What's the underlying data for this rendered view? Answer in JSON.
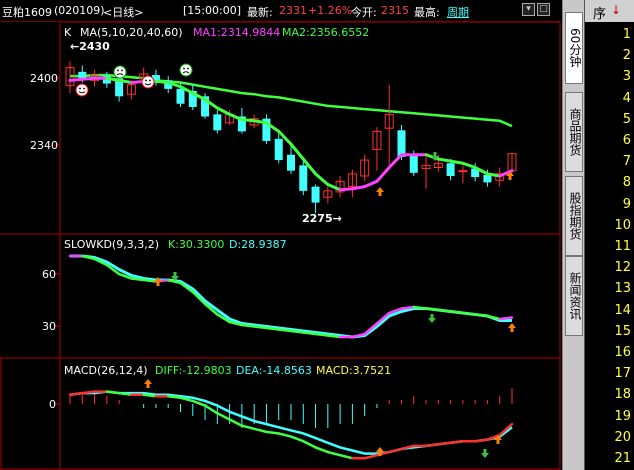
{
  "header": {
    "instrument": "豆粕1609",
    "code": "(020109)",
    "period": "<日线>",
    "time": "[15:00:00]",
    "latest_label": "最新:",
    "latest_value": "2331",
    "change": "+1.26%",
    "open_label": "今开:",
    "open_value": "2315",
    "high_label": "最高:",
    "period_link": "周期"
  },
  "main_panel": {
    "legend_k": "K",
    "legend_ma": "MA(5,10,20,40,60)",
    "ma1": "MA1:2314.9844",
    "ma2": "MA2:2356.6552",
    "y_labels": [
      "2400",
      "2340"
    ],
    "high_marker": "2430",
    "low_marker": "2275"
  },
  "kd_panel": {
    "title": "SLOWKD(9,3,3,2)",
    "k": "K:30.3300",
    "d": "D:28.9387",
    "y_labels": [
      "60",
      "30"
    ]
  },
  "macd_panel": {
    "title": "MACD(26,12,4)",
    "diff": "DIFF:-12.9803",
    "dea": "DEA:-14.8563",
    "macd": "MACD:3.7521",
    "y_labels": [
      "0"
    ]
  },
  "right_tabs": [
    "60分钟",
    "商品期货",
    "股指期货",
    "新闻资讯"
  ],
  "seq_header": "序",
  "seq_numbers": [
    "1",
    "2",
    "3",
    "4",
    "5",
    "6",
    "7",
    "8",
    "9",
    "10",
    "11",
    "12",
    "13",
    "14",
    "15",
    "16",
    "17",
    "18",
    "19",
    "20",
    "21"
  ],
  "colors": {
    "up": "#ff3030",
    "down": "#40ffff",
    "ma_short": "#ff40ff",
    "ma_long": "#40ff40",
    "panel_border": "#b00000",
    "kd_k": "#ff40ff",
    "kd_d": "#40ffff"
  },
  "chart_data": {
    "type": "candlestick",
    "title": "",
    "ylim": [
      2262,
      2438
    ],
    "candles": [
      {
        "o": 2395,
        "h": 2418,
        "l": 2388,
        "c": 2412
      },
      {
        "o": 2408,
        "h": 2414,
        "l": 2398,
        "c": 2402
      },
      {
        "o": 2400,
        "h": 2410,
        "l": 2394,
        "c": 2405
      },
      {
        "o": 2404,
        "h": 2408,
        "l": 2393,
        "c": 2397
      },
      {
        "o": 2402,
        "h": 2410,
        "l": 2380,
        "c": 2385
      },
      {
        "o": 2387,
        "h": 2400,
        "l": 2382,
        "c": 2396
      },
      {
        "o": 2402,
        "h": 2412,
        "l": 2398,
        "c": 2406
      },
      {
        "o": 2405,
        "h": 2410,
        "l": 2395,
        "c": 2399
      },
      {
        "o": 2400,
        "h": 2404,
        "l": 2388,
        "c": 2392
      },
      {
        "o": 2392,
        "h": 2398,
        "l": 2375,
        "c": 2378
      },
      {
        "o": 2390,
        "h": 2396,
        "l": 2372,
        "c": 2375
      },
      {
        "o": 2385,
        "h": 2388,
        "l": 2364,
        "c": 2366
      },
      {
        "o": 2368,
        "h": 2372,
        "l": 2350,
        "c": 2353
      },
      {
        "o": 2360,
        "h": 2372,
        "l": 2358,
        "c": 2368
      },
      {
        "o": 2366,
        "h": 2374,
        "l": 2350,
        "c": 2352
      },
      {
        "o": 2358,
        "h": 2368,
        "l": 2355,
        "c": 2364
      },
      {
        "o": 2364,
        "h": 2368,
        "l": 2340,
        "c": 2343
      },
      {
        "o": 2345,
        "h": 2350,
        "l": 2322,
        "c": 2325
      },
      {
        "o": 2330,
        "h": 2338,
        "l": 2312,
        "c": 2315
      },
      {
        "o": 2320,
        "h": 2324,
        "l": 2292,
        "c": 2296
      },
      {
        "o": 2300,
        "h": 2302,
        "l": 2275,
        "c": 2285
      },
      {
        "o": 2290,
        "h": 2300,
        "l": 2284,
        "c": 2296
      },
      {
        "o": 2295,
        "h": 2310,
        "l": 2290,
        "c": 2305
      },
      {
        "o": 2300,
        "h": 2316,
        "l": 2290,
        "c": 2312
      },
      {
        "o": 2310,
        "h": 2330,
        "l": 2305,
        "c": 2325
      },
      {
        "o": 2335,
        "h": 2356,
        "l": 2315,
        "c": 2352
      },
      {
        "o": 2355,
        "h": 2396,
        "l": 2318,
        "c": 2368
      },
      {
        "o": 2353,
        "h": 2358,
        "l": 2325,
        "c": 2328
      },
      {
        "o": 2330,
        "h": 2334,
        "l": 2310,
        "c": 2313
      },
      {
        "o": 2317,
        "h": 2328,
        "l": 2298,
        "c": 2320
      },
      {
        "o": 2318,
        "h": 2330,
        "l": 2314,
        "c": 2322
      },
      {
        "o": 2322,
        "h": 2326,
        "l": 2306,
        "c": 2310
      },
      {
        "o": 2314,
        "h": 2320,
        "l": 2303,
        "c": 2315
      },
      {
        "o": 2317,
        "h": 2322,
        "l": 2305,
        "c": 2309
      },
      {
        "o": 2311,
        "h": 2316,
        "l": 2300,
        "c": 2304
      },
      {
        "o": 2306,
        "h": 2318,
        "l": 2300,
        "c": 2312
      },
      {
        "o": 2315,
        "h": 2332,
        "l": 2313,
        "c": 2331
      }
    ],
    "ma1": [
      2400,
      2401,
      2402,
      2402,
      2400,
      2398,
      2399,
      2399,
      2398,
      2394,
      2388,
      2382,
      2374,
      2368,
      2363,
      2362,
      2360,
      2352,
      2340,
      2326,
      2312,
      2302,
      2297,
      2298,
      2300,
      2305,
      2318,
      2330,
      2330,
      2330,
      2326,
      2324,
      2322,
      2318,
      2312,
      2310,
      2315
    ],
    "ma2": [
      2404,
      2404,
      2405,
      2405,
      2404,
      2403,
      2402,
      2400,
      2399,
      2398,
      2396,
      2394,
      2392,
      2390,
      2388,
      2387,
      2385,
      2384,
      2382,
      2380,
      2378,
      2376,
      2375,
      2374,
      2373,
      2372,
      2371,
      2370,
      2369,
      2368,
      2367,
      2366,
      2365,
      2364,
      2363,
      2362,
      2357
    ]
  },
  "kd_chart": {
    "k": [
      72,
      72,
      70,
      66,
      60,
      57,
      56,
      55,
      56,
      54,
      48,
      40,
      33,
      28,
      26,
      25,
      24,
      23,
      22,
      21,
      20,
      19,
      18,
      18,
      20,
      27,
      34,
      37,
      38,
      37,
      36,
      35,
      34,
      33,
      32,
      30,
      31
    ],
    "d": [
      72,
      72,
      71,
      68,
      63,
      59,
      57,
      56,
      56,
      55,
      50,
      42,
      36,
      30,
      27,
      26,
      25,
      24,
      23,
      22,
      21,
      20,
      19,
      18,
      19,
      25,
      32,
      35,
      37,
      37,
      36,
      35,
      34,
      33,
      32,
      29,
      29
    ]
  },
  "macd_chart": {
    "diff": [
      6,
      7,
      8,
      8,
      7,
      6,
      6,
      5,
      5,
      4,
      2,
      -1,
      -6,
      -10,
      -14,
      -16,
      -18,
      -19,
      -21,
      -24,
      -28,
      -31,
      -33,
      -35,
      -35,
      -33,
      -31,
      -29,
      -27,
      -27,
      -26,
      -25,
      -24,
      -24,
      -23,
      -20,
      -13
    ],
    "dea": [
      6,
      7,
      7,
      8,
      7,
      7,
      7,
      6,
      6,
      5,
      4,
      2,
      -1,
      -5,
      -8,
      -11,
      -13,
      -15,
      -17,
      -19,
      -22,
      -25,
      -28,
      -30,
      -32,
      -32,
      -31,
      -29,
      -28,
      -27,
      -26,
      -25,
      -24,
      -24,
      -23,
      -21,
      -15
    ],
    "bar": [
      2,
      3,
      3,
      2,
      1,
      0,
      -1,
      -1,
      -1,
      -2,
      -3,
      -4,
      -5,
      -5,
      -6,
      -5,
      -5,
      -4,
      -4,
      -5,
      -6,
      -6,
      -5,
      -5,
      -3,
      -1,
      1,
      1,
      2,
      1,
      1,
      1,
      1,
      1,
      1,
      2,
      4
    ]
  }
}
